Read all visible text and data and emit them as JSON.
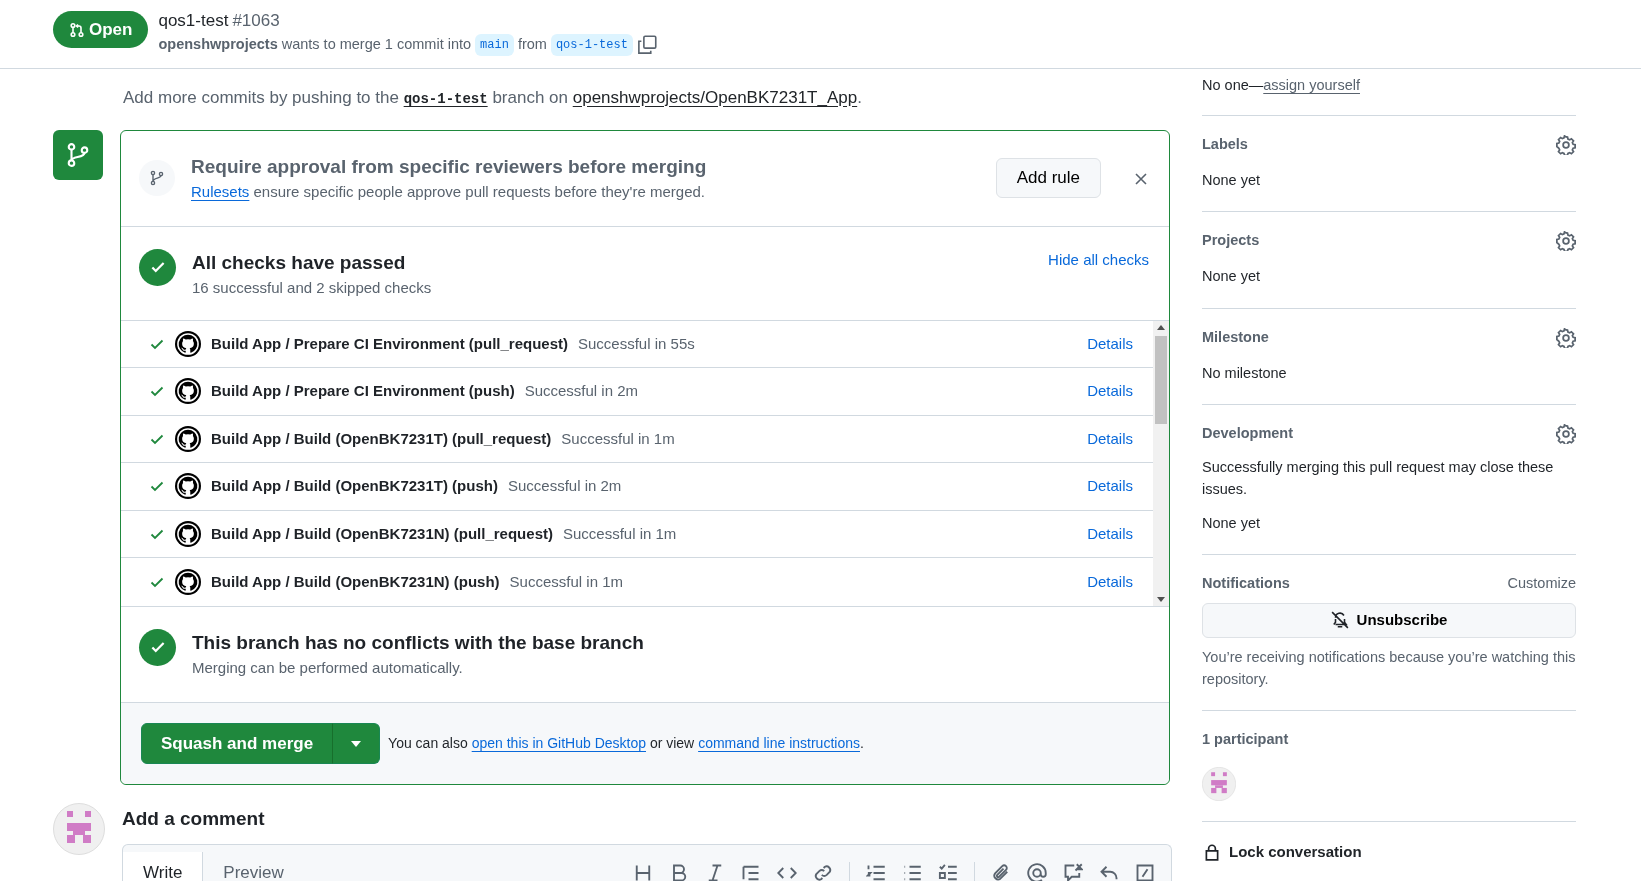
{
  "header": {
    "state": "Open",
    "title": "qos1-test",
    "number": "#1063",
    "author": "openshwprojects",
    "merge_text": "wants to merge 1 commit into",
    "base_branch": "main",
    "from_text": "from",
    "head_branch": "qos-1-test"
  },
  "push_hint": {
    "before": "Add more commits by pushing to the",
    "branch": "qos-1-test",
    "middle": "branch on",
    "repo": "openshwprojects/OpenBK7231T_App",
    "after": "."
  },
  "ruleset_banner": {
    "title": "Require approval from specific reviewers before merging",
    "link": "Rulesets",
    "text": "ensure specific people approve pull requests before they're merged.",
    "button": "Add rule"
  },
  "checks": {
    "title": "All checks have passed",
    "summary": "16 successful and 2 skipped checks",
    "toggle": "Hide all checks",
    "items": [
      {
        "name": "Build App / Prepare CI Environment (pull_request)",
        "status": "Successful in 55s",
        "link": "Details"
      },
      {
        "name": "Build App / Prepare CI Environment (push)",
        "status": "Successful in 2m",
        "link": "Details"
      },
      {
        "name": "Build App / Build (OpenBK7231T) (pull_request)",
        "status": "Successful in 1m",
        "link": "Details"
      },
      {
        "name": "Build App / Build (OpenBK7231T) (push)",
        "status": "Successful in 2m",
        "link": "Details"
      },
      {
        "name": "Build App / Build (OpenBK7231N) (pull_request)",
        "status": "Successful in 1m",
        "link": "Details"
      },
      {
        "name": "Build App / Build (OpenBK7231N) (push)",
        "status": "Successful in 1m",
        "link": "Details"
      }
    ]
  },
  "conflicts": {
    "title": "This branch has no conflicts with the base branch",
    "subtitle": "Merging can be performed automatically."
  },
  "merge": {
    "button": "Squash and merge",
    "note_before": "You can also",
    "desktop_link": "open this in GitHub Desktop",
    "note_middle": "or view",
    "cli_link": "command line instructions",
    "note_after": "."
  },
  "comment": {
    "heading": "Add a comment",
    "tabs": [
      {
        "label": "Write",
        "selected": true
      },
      {
        "label": "Preview",
        "selected": false
      }
    ]
  },
  "sidebar": {
    "assignees": {
      "text": "No one—",
      "link": "assign yourself"
    },
    "sections": [
      {
        "title": "Labels",
        "value": "None yet"
      },
      {
        "title": "Projects",
        "value": "None yet"
      },
      {
        "title": "Milestone",
        "value": "No milestone"
      },
      {
        "title": "Development",
        "text": "Successfully merging this pull request may close these issues.",
        "value": "None yet"
      }
    ],
    "notifications": {
      "title": "Notifications",
      "customize": "Customize",
      "button": "Unsubscribe",
      "reason": "You’re receiving notifications because you’re watching this repository."
    },
    "participants": {
      "title": "1 participant"
    },
    "lock": "Lock conversation"
  }
}
